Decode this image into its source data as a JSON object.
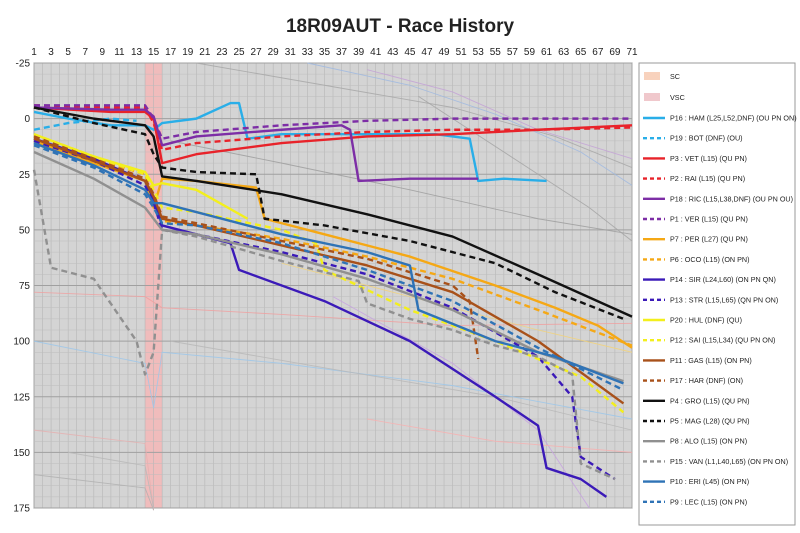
{
  "chart_data": {
    "type": "line",
    "title": "18R09AUT - Race History",
    "xlabel": "",
    "ylabel": "",
    "xlim": [
      1,
      71
    ],
    "ylim": [
      -25,
      175
    ],
    "y_inverted": true,
    "x_axis_position": "top",
    "x_ticks": [
      1,
      3,
      5,
      7,
      9,
      11,
      13,
      15,
      17,
      19,
      21,
      23,
      25,
      27,
      29,
      31,
      33,
      35,
      37,
      39,
      41,
      43,
      45,
      47,
      49,
      51,
      53,
      55,
      57,
      59,
      61,
      63,
      65,
      67,
      69,
      71
    ],
    "y_ticks": [
      -25,
      0,
      25,
      50,
      75,
      100,
      125,
      150,
      175
    ],
    "grid": true,
    "legend_position": "right",
    "shaded_bands": [
      {
        "name": "SC",
        "x_start": 14,
        "x_end": 16,
        "color": "#f3b9b9"
      }
    ],
    "legend_patches": [
      {
        "label": "SC",
        "color": "#f8d2bd"
      },
      {
        "label": "VSC",
        "color": "#f0c8cc"
      }
    ],
    "series": [
      {
        "name": "P16 : HAM (L25,L52,DNF) (OU PN ON)",
        "color": "#29aee8",
        "dash": "solid",
        "x": [
          1,
          5,
          10,
          14,
          15,
          16,
          20,
          24,
          25,
          26,
          30,
          36,
          40,
          48,
          52,
          53,
          56,
          61
        ],
        "y": [
          -3,
          0,
          3,
          3,
          5,
          2,
          0,
          -7,
          -7,
          9,
          7,
          7,
          7,
          7,
          9,
          28,
          27,
          28
        ]
      },
      {
        "name": "P19 : BOT (DNF) (OU)",
        "color": "#29aee8",
        "dash": "dashed",
        "x": [
          1,
          5,
          10,
          13
        ],
        "y": [
          5,
          2,
          0,
          1
        ]
      },
      {
        "name": "P3 : VET (L15) (QU PN)",
        "color": "#e8232a",
        "dash": "solid",
        "x": [
          1,
          10,
          14,
          15,
          16,
          20,
          30,
          40,
          50,
          60,
          71
        ],
        "y": [
          -5,
          -3,
          -3,
          0,
          20,
          16,
          11,
          8,
          7,
          5,
          3
        ]
      },
      {
        "name": "P2 : RAI (L15) (QU PN)",
        "color": "#e8232a",
        "dash": "dashed",
        "x": [
          1,
          10,
          14,
          15,
          16,
          20,
          30,
          40,
          50,
          60,
          71
        ],
        "y": [
          -6,
          -5,
          -5,
          2,
          14,
          11,
          8,
          6,
          5,
          5,
          4
        ]
      },
      {
        "name": "P18 : RIC (L15,L38,DNF) (OU PN OU)",
        "color": "#7d2ea6",
        "dash": "solid",
        "x": [
          1,
          10,
          14,
          15,
          16,
          20,
          30,
          37,
          38,
          39,
          45,
          53
        ],
        "y": [
          -5,
          -4,
          -4,
          -1,
          12,
          8,
          5,
          3,
          5,
          28,
          27,
          27
        ]
      },
      {
        "name": "P1 : VER (L15) (QU PN)",
        "color": "#7d2ea6",
        "dash": "dashed",
        "x": [
          1,
          10,
          14,
          15,
          16,
          20,
          30,
          40,
          50,
          60,
          71
        ],
        "y": [
          -6,
          -6,
          -6,
          0,
          9,
          6,
          3,
          1,
          0,
          0,
          0
        ]
      },
      {
        "name": "P7 : PER (L27) (QU PN)",
        "color": "#f5a815",
        "dash": "solid",
        "x": [
          1,
          8,
          14,
          15,
          16,
          20,
          27,
          28,
          35,
          45,
          55,
          62,
          67,
          71
        ],
        "y": [
          10,
          20,
          28,
          40,
          27,
          28,
          31,
          45,
          52,
          62,
          75,
          85,
          93,
          103
        ]
      },
      {
        "name": "P6 : OCO (L15) (ON PN)",
        "color": "#f5a815",
        "dash": "dashed",
        "x": [
          1,
          8,
          14,
          15,
          16,
          20,
          30,
          40,
          50,
          60,
          71
        ],
        "y": [
          8,
          18,
          25,
          35,
          46,
          48,
          54,
          62,
          72,
          86,
          102
        ]
      },
      {
        "name": "P14 : SIR (L24,L60) (ON PN QN)",
        "color": "#3b1ab8",
        "dash": "solid",
        "x": [
          1,
          8,
          14,
          15,
          16,
          20,
          24,
          25,
          35,
          45,
          55,
          60,
          61,
          65,
          68
        ],
        "y": [
          9,
          18,
          28,
          36,
          48,
          52,
          56,
          68,
          82,
          100,
          125,
          138,
          157,
          162,
          170
        ]
      },
      {
        "name": "P13 : STR (L15,L65) (QN PN ON)",
        "color": "#3b1ab8",
        "dash": "dashed",
        "x": [
          1,
          8,
          14,
          15,
          16,
          20,
          30,
          40,
          50,
          60,
          64,
          65,
          69
        ],
        "y": [
          10,
          19,
          30,
          38,
          50,
          52,
          60,
          70,
          85,
          107,
          125,
          152,
          162
        ]
      },
      {
        "name": "P20 : HUL (DNF) (QU)",
        "color": "#f3ef1c",
        "dash": "solid",
        "x": [
          1,
          8,
          14,
          15,
          16,
          20,
          26
        ],
        "y": [
          7,
          17,
          24,
          30,
          29,
          32,
          45
        ]
      },
      {
        "name": "P12 : SAI (L15,L34) (QU PN ON)",
        "color": "#f3ef1c",
        "dash": "dashed",
        "x": [
          1,
          8,
          14,
          15,
          16,
          20,
          30,
          34,
          35,
          45,
          55,
          65,
          70
        ],
        "y": [
          7,
          17,
          25,
          32,
          40,
          42,
          50,
          56,
          68,
          86,
          100,
          116,
          132
        ]
      },
      {
        "name": "P11 : GAS (L15) (ON PN)",
        "color": "#a8511a",
        "dash": "solid",
        "x": [
          1,
          8,
          14,
          15,
          16,
          20,
          30,
          40,
          50,
          60,
          70
        ],
        "y": [
          9,
          19,
          28,
          35,
          45,
          48,
          57,
          66,
          78,
          100,
          128
        ]
      },
      {
        "name": "P17 : HAR (DNF) (ON)",
        "color": "#a8511a",
        "dash": "dashed",
        "x": [
          1,
          8,
          14,
          15,
          16,
          20,
          30,
          40,
          50,
          52,
          53
        ],
        "y": [
          8,
          18,
          27,
          34,
          44,
          47,
          55,
          63,
          75,
          82,
          108
        ]
      },
      {
        "name": "P4 : GRO (L15) (QU PN)",
        "color": "#111111",
        "dash": "solid",
        "x": [
          1,
          8,
          14,
          15,
          16,
          20,
          30,
          40,
          50,
          60,
          71
        ],
        "y": [
          -5,
          0,
          3,
          8,
          26,
          28,
          34,
          43,
          53,
          70,
          89
        ]
      },
      {
        "name": "P5 : MAG (L28) (QU PN)",
        "color": "#111111",
        "dash": "dashed",
        "x": [
          1,
          8,
          14,
          15,
          16,
          20,
          27,
          28,
          35,
          45,
          55,
          62,
          70
        ],
        "y": [
          -5,
          2,
          7,
          16,
          22,
          24,
          25,
          45,
          48,
          55,
          65,
          78,
          90
        ]
      },
      {
        "name": "P8 : ALO (L15) (ON PN)",
        "color": "#909090",
        "dash": "solid",
        "x": [
          1,
          8,
          14,
          15,
          16,
          20,
          30,
          40,
          50,
          60,
          70
        ],
        "y": [
          15,
          27,
          40,
          45,
          50,
          52,
          61,
          72,
          86,
          105,
          118
        ]
      },
      {
        "name": "P15 : VAN (L1,L40,L65) (ON PN ON)",
        "color": "#909090",
        "dash": "dashed",
        "x": [
          1,
          2,
          3,
          8,
          13,
          14,
          15,
          16,
          20,
          30,
          39,
          40,
          45,
          50,
          55,
          60,
          64,
          65,
          69
        ],
        "y": [
          23,
          45,
          67,
          72,
          100,
          115,
          105,
          50,
          53,
          64,
          73,
          83,
          90,
          95,
          102,
          107,
          115,
          155,
          162
        ]
      },
      {
        "name": "P10 : ERI (L45) (ON PN)",
        "color": "#2f73b6",
        "dash": "solid",
        "x": [
          1,
          8,
          14,
          15,
          16,
          20,
          30,
          40,
          45,
          46,
          55,
          62,
          70
        ],
        "y": [
          11,
          21,
          32,
          38,
          38,
          42,
          52,
          60,
          66,
          86,
          100,
          107,
          119
        ]
      },
      {
        "name": "P9 : LEC (L15) (ON PN)",
        "color": "#2f73b6",
        "dash": "dashed",
        "x": [
          1,
          8,
          14,
          15,
          16,
          20,
          30,
          40,
          50,
          60,
          70
        ],
        "y": [
          12,
          22,
          34,
          40,
          47,
          48,
          56,
          68,
          82,
          103,
          122
        ]
      }
    ]
  }
}
